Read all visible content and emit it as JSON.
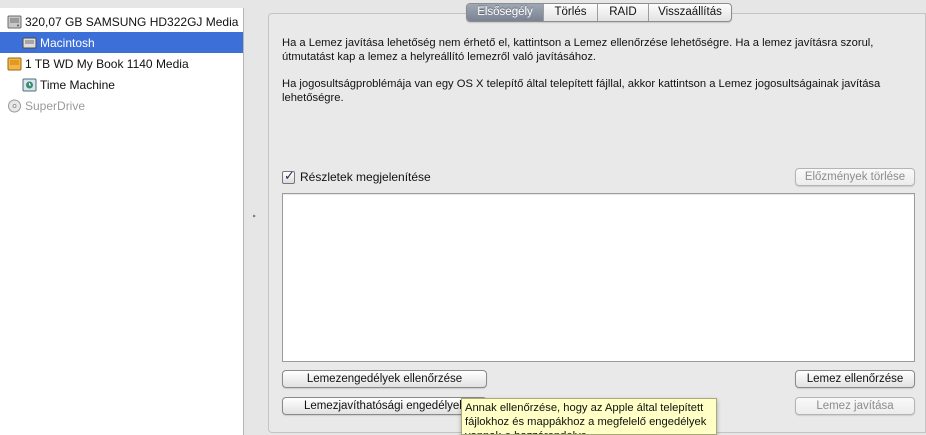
{
  "sidebar": {
    "items": [
      {
        "label": "320,07 GB SAMSUNG HD322GJ Media",
        "icon": "internal-disk-icon"
      },
      {
        "label": "Macintosh",
        "icon": "volume-icon",
        "selected": true
      },
      {
        "label": "1 TB WD My Book 1140 Media",
        "icon": "external-disk-icon"
      },
      {
        "label": "Time Machine",
        "icon": "time-machine-volume-icon"
      },
      {
        "label": "SuperDrive",
        "icon": "optical-drive-icon",
        "disabled": true
      }
    ]
  },
  "tabs": [
    {
      "label": "Elsősegély",
      "active": true
    },
    {
      "label": "Törlés"
    },
    {
      "label": "RAID"
    },
    {
      "label": "Visszaállítás"
    }
  ],
  "info": {
    "paragraph1": "Ha a Lemez javítása lehetőség nem érhető el, kattintson a Lemez ellenőrzése lehetőségre. Ha a lemez javításra szorul, útmutatást kap a lemez a helyreállító lemezről való javításához.",
    "paragraph2": "Ha jogosultságproblémája van egy OS X telepítő által telepített fájllal, akkor kattintson a Lemez jogosultságainak javítása lehetőségre."
  },
  "details_checkbox": {
    "label": "Részletek megjelenítése",
    "checked": true
  },
  "buttons": {
    "clear_history": "Előzmények törlése",
    "verify_permissions": "Lemezengedélyek ellenőrzése",
    "repair_permissions": "Lemezjavíthatósági engedélyek",
    "verify_disk": "Lemez ellenőrzése",
    "repair_disk": "Lemez javítása"
  },
  "tooltip": {
    "text": "Annak ellenőrzése, hogy az Apple által telepített fájlokhoz és mappákhoz a megfelelő engedélyek vannak-e hozzárendelve."
  },
  "colors": {
    "selection": "#3d6fd8",
    "tab_active": "#7a8392",
    "tooltip_bg": "#ffffc6"
  }
}
